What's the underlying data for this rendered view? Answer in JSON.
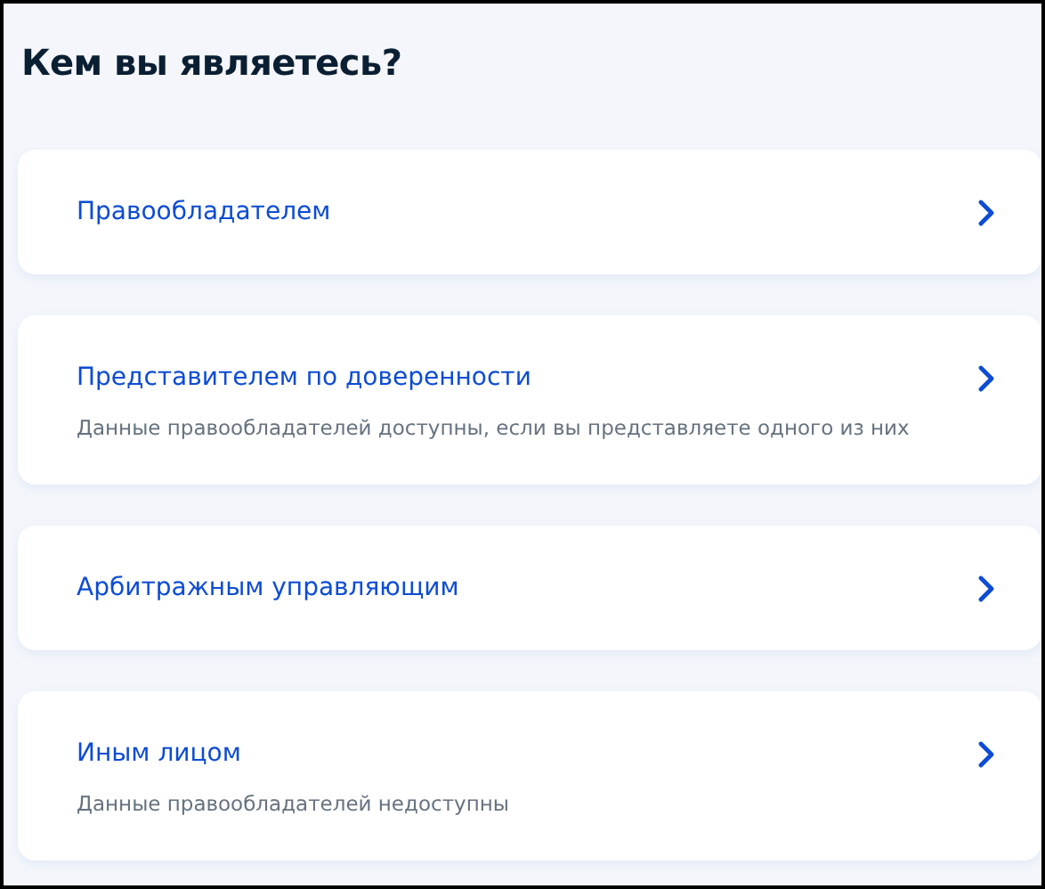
{
  "title": "Кем вы являетесь?",
  "options": [
    {
      "label": "Правообладателем"
    },
    {
      "label": "Представителем по доверенности",
      "description": "Данные правообладателей доступны, если вы представляете одного из них"
    },
    {
      "label": "Арбитражным управляющим"
    },
    {
      "label": "Иным лицом",
      "description": "Данные правообладателей недоступны"
    }
  ]
}
